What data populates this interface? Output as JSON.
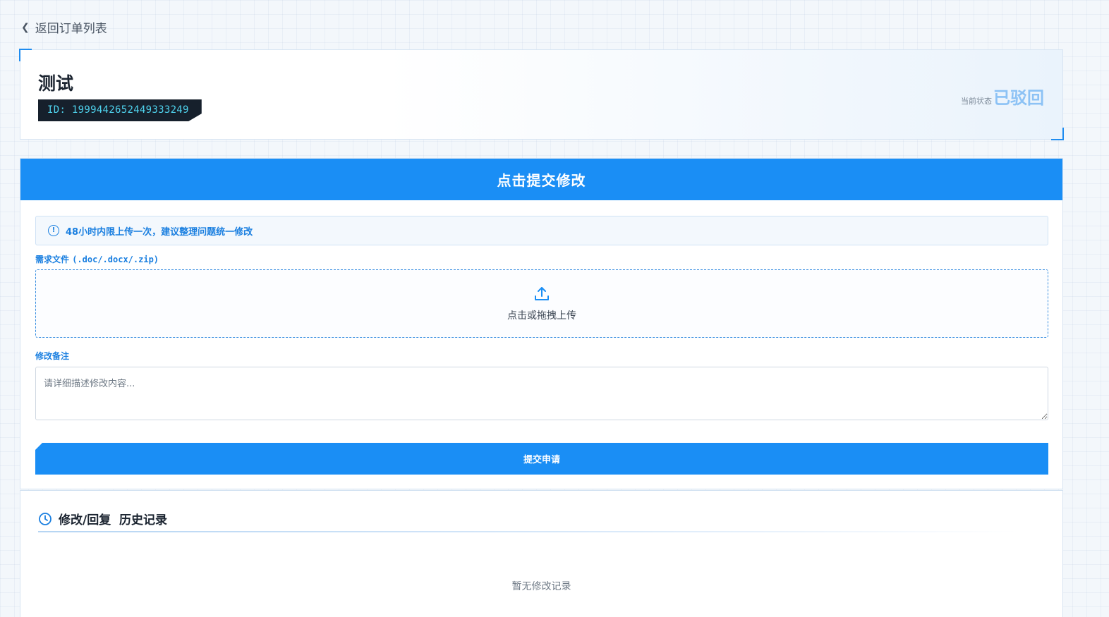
{
  "nav": {
    "back_label": "返回订单列表"
  },
  "order": {
    "title": "测试",
    "id_text": "ID: 1999442652449333249",
    "status_label": "当前状态",
    "status_value": "已驳回"
  },
  "submit_panel": {
    "banner_title": "点击提交修改",
    "notice_text": "48小时内限上传一次，建议整理问题统一修改",
    "requirement_label": "需求文件",
    "requirement_ext": "(.doc/.docx/.zip)",
    "upload_text": "点击或拖拽上传",
    "note_label": "修改备注",
    "note_placeholder": "请详细描述修改内容...",
    "note_value": "",
    "submit_label": "提交申请"
  },
  "history": {
    "title": "修改/回复  历史记录",
    "empty_text": "暂无修改记录"
  },
  "colors": {
    "accent": "#1a8ef5",
    "status": "#8cc2f5",
    "id_badge_bg": "#16202c",
    "id_badge_text": "#4fd3ee"
  },
  "icons": {
    "back": "chevron-left-icon",
    "notice": "info-circle-icon",
    "upload": "upload-icon",
    "history": "clock-icon"
  }
}
